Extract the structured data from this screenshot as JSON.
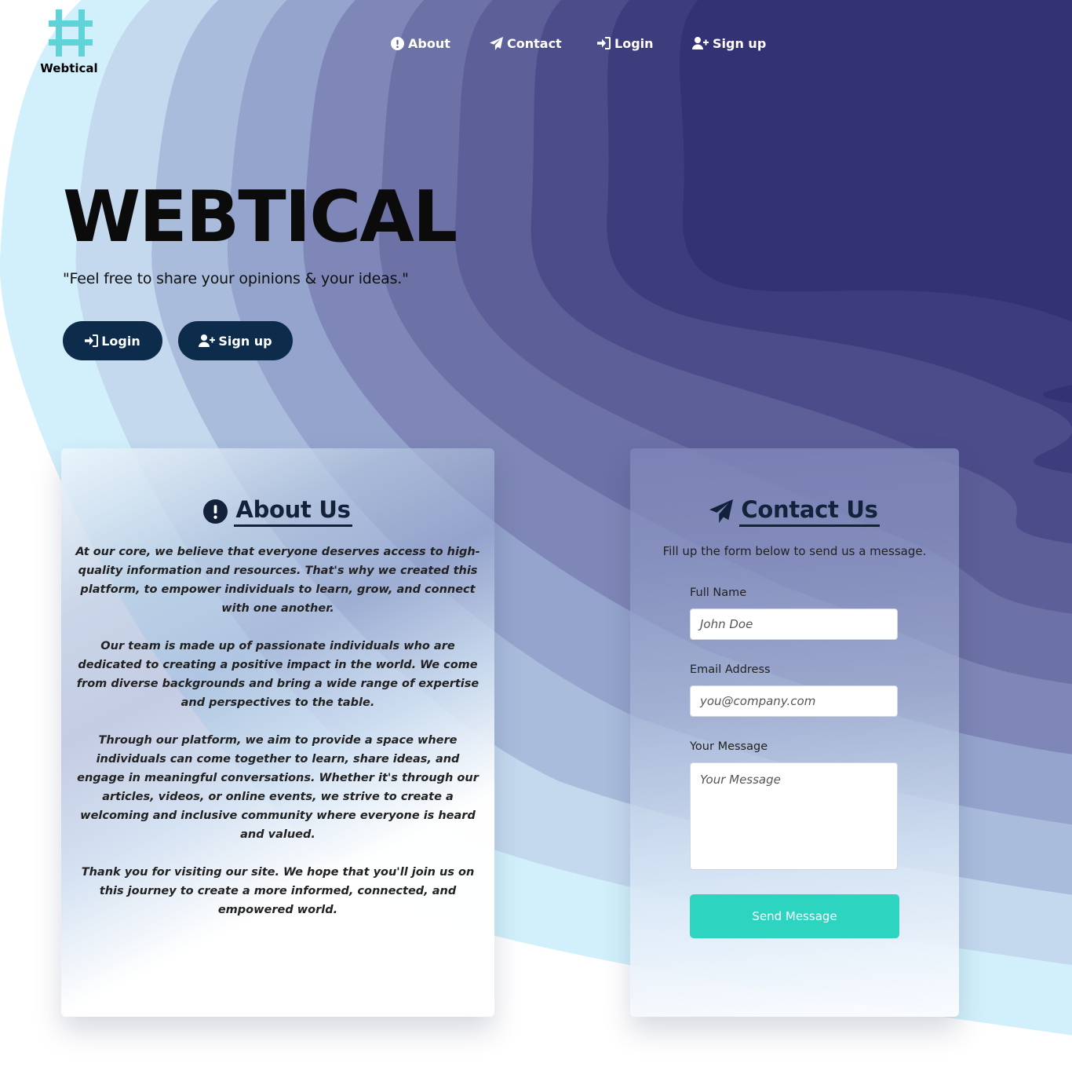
{
  "brand": {
    "name": "Webtical",
    "logo_icon": "hash-icon",
    "logo_color": "#5fd3d7"
  },
  "nav": {
    "items": [
      {
        "label": "About",
        "icon": "info-circle-icon"
      },
      {
        "label": "Contact",
        "icon": "paper-plane-icon"
      },
      {
        "label": "Login",
        "icon": "sign-in-icon"
      },
      {
        "label": "Sign up",
        "icon": "user-plus-icon"
      }
    ]
  },
  "hero": {
    "title": "WEBTICAL",
    "tagline": "\"Feel free to share your opinions & your ideas.\"",
    "login_label": "Login",
    "signup_label": "Sign up",
    "button_color": "#0d2b4b"
  },
  "about": {
    "heading": "About Us",
    "icon": "exclamation-circle-icon",
    "paragraphs": [
      "At our core, we believe that everyone deserves access to high-quality information and resources. That's why we created this platform, to empower individuals to learn, grow, and connect with one another.",
      "Our team is made up of passionate individuals who are dedicated to creating a positive impact in the world. We come from diverse backgrounds and bring a wide range of expertise and perspectives to the table.",
      "Through our platform, we aim to provide a space where individuals can come together to learn, share ideas, and engage in meaningful conversations. Whether it's through our articles, videos, or online events, we strive to create a welcoming and inclusive community where everyone is heard and valued.",
      "Thank you for visiting our site. We hope that you'll join us on this journey to create a more informed, connected, and empowered world."
    ]
  },
  "contact": {
    "heading": "Contact Us",
    "icon": "paper-plane-icon",
    "subtitle": "Fill up the form below to send us a message.",
    "fields": {
      "name": {
        "label": "Full Name",
        "placeholder": "John Doe",
        "value": ""
      },
      "email": {
        "label": "Email Address",
        "placeholder": "you@company.com",
        "value": ""
      },
      "message": {
        "label": "Your Message",
        "placeholder": "Your Message",
        "value": ""
      }
    },
    "submit_label": "Send Message",
    "submit_color": "#2dd4c0"
  },
  "theme": {
    "wave_colors": [
      "#d2f0fb",
      "#c4d9ee",
      "#a9bcdc",
      "#94a4cc",
      "#7e87b7",
      "#6c71a6",
      "#5d5f99",
      "#4c4c8b",
      "#3d3d7e",
      "#323274"
    ]
  }
}
